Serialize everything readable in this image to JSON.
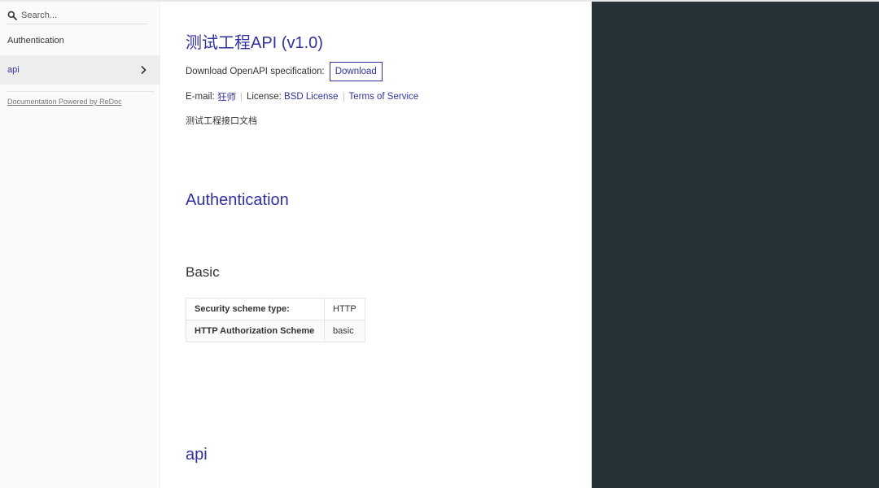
{
  "sidebar": {
    "search": {
      "placeholder": "Search..."
    },
    "items": [
      {
        "label": "Authentication"
      },
      {
        "label": "api"
      }
    ],
    "powered_by": "Documentation Powered by ReDoc"
  },
  "main": {
    "title": "测试工程API (v1.0)",
    "download": {
      "label": "Download OpenAPI specification:",
      "button": "Download"
    },
    "info": {
      "email_label": "E-mail:",
      "email_value": "狂师",
      "license_label": "License:",
      "license_value": "BSD License",
      "terms": "Terms of Service"
    },
    "description": "测试工程接口文档",
    "auth_heading": "Authentication",
    "basic_heading": "Basic",
    "scheme_table": [
      {
        "key": "Security scheme type:",
        "value": "HTTP"
      },
      {
        "key": "HTTP Authorization Scheme",
        "value": "basic"
      }
    ],
    "api_heading": "api"
  },
  "colors": {
    "accent": "#32329f",
    "right_panel": "#263238",
    "sidebar_bg": "#fafafa",
    "active_item_bg": "#ededed"
  }
}
